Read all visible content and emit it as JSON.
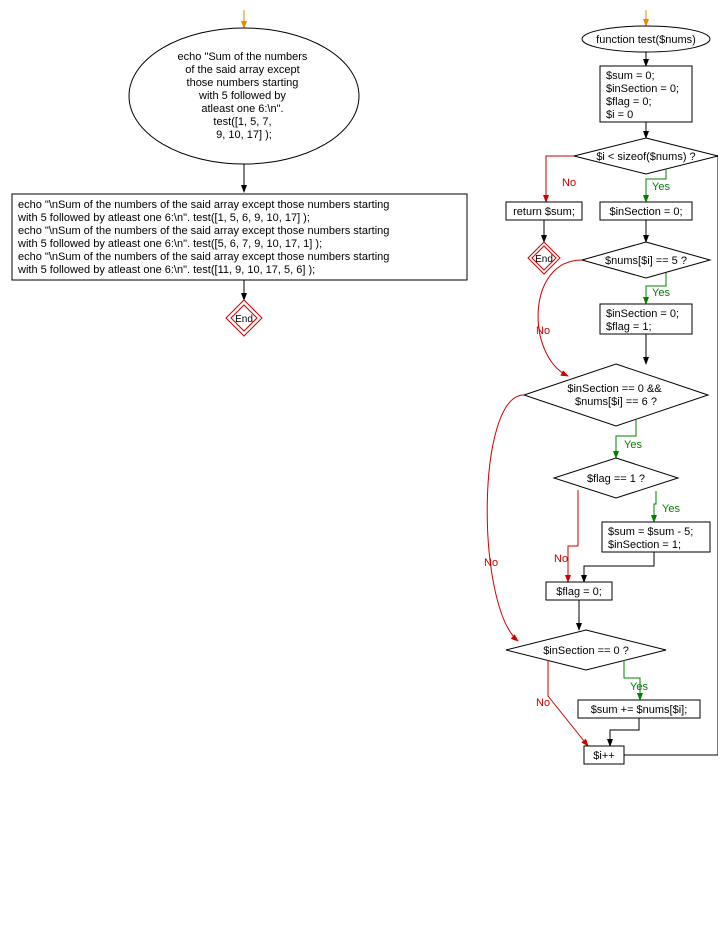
{
  "left": {
    "start_lines": [
      "echo \"Sum of the numbers",
      "of the said array except",
      "those numbers starting",
      "with 5 followed by",
      "atleast one 6:\\n\".",
      "test([1, 5, 7,",
      "9, 10, 17] );"
    ],
    "echo_block": [
      "echo \"\\nSum of the numbers of the said array except those numbers starting",
      "with 5 followed by atleast one 6:\\n\". test([1, 5, 6, 9, 10, 17] );",
      "echo \"\\nSum of the numbers of the said array except those numbers starting",
      "with 5 followed by atleast one 6:\\n\". test([5, 6, 7, 9, 10, 17, 1] );",
      "echo \"\\nSum of the numbers of the said array except those numbers starting",
      "with 5 followed by atleast one 6:\\n\". test([11, 9, 10, 17, 5, 6] );"
    ],
    "end": "End"
  },
  "right": {
    "func": "function test($nums)",
    "init": [
      "$sum = 0;",
      "$inSection = 0;",
      "$flag = 0;",
      "$i = 0"
    ],
    "cond_loop": "$i < sizeof($nums) ?",
    "return": "return $sum;",
    "end": "End",
    "in0a": "$inSection = 0;",
    "cond_eq5": "$nums[$i] == 5 ?",
    "set5": [
      "$inSection = 0;",
      "$flag = 1;"
    ],
    "cond_eq6": [
      "$inSection == 0 &&",
      "$nums[$i] == 6 ?"
    ],
    "cond_flag": "$flag == 1 ?",
    "sub5": [
      "$sum = $sum - 5;",
      "$inSection = 1;"
    ],
    "flag0": "$flag = 0;",
    "cond_in0": "$inSection == 0 ?",
    "addsum": "$sum += $nums[$i];",
    "incr": "$i++"
  },
  "labels": {
    "yes": "Yes",
    "no": "No"
  }
}
